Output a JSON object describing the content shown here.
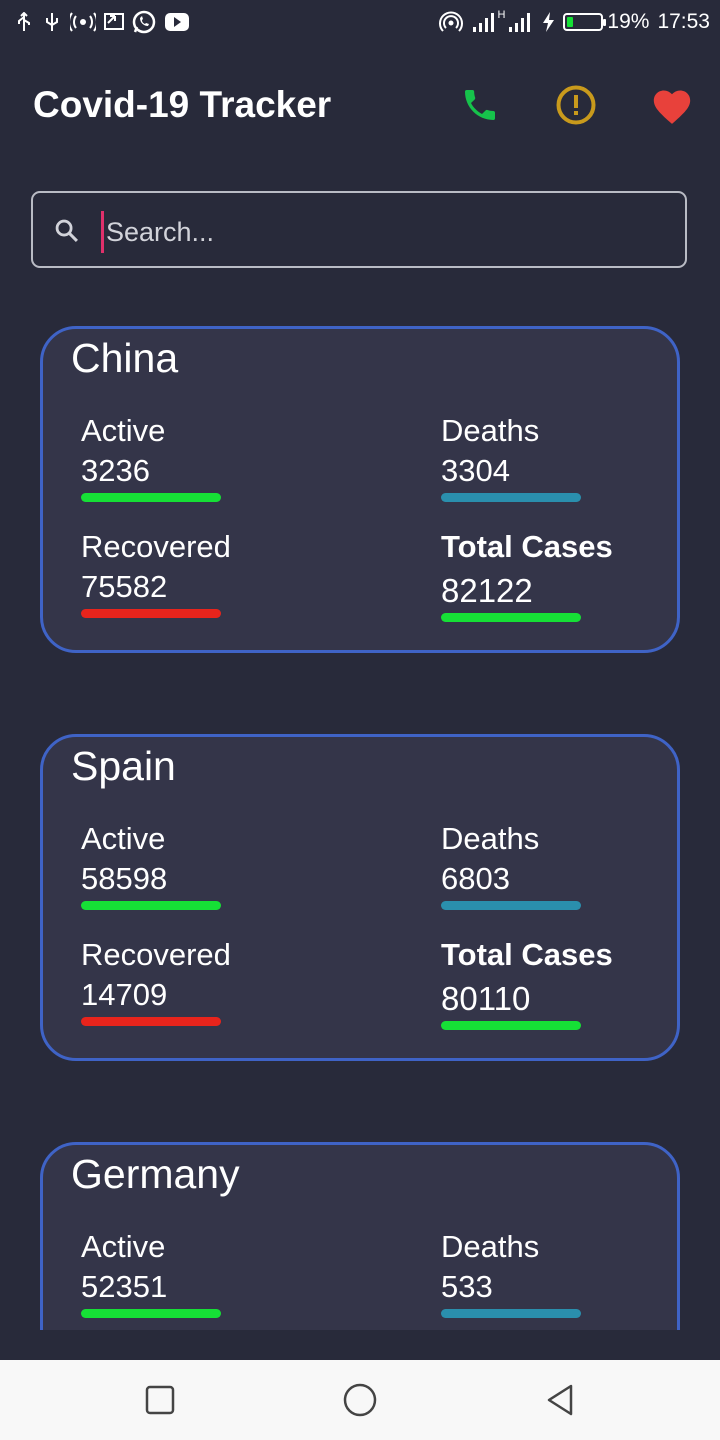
{
  "status_bar": {
    "left_icons": [
      "usb-icon",
      "usb-debug-icon",
      "hotspot-icon",
      "cast-icon",
      "whatsapp-icon",
      "youtube-icon"
    ],
    "battery_percent": "19%",
    "battery_level": 0.19,
    "time": "17:53",
    "signal_label": "H"
  },
  "app": {
    "title": "Covid-19 Tracker",
    "icons": {
      "phone": "phone-icon",
      "alert": "alert-icon",
      "favorite": "heart-icon"
    },
    "colors": {
      "phone": "#16c24b",
      "alert": "#c99a1c",
      "heart": "#e8413b"
    }
  },
  "search": {
    "placeholder": "Search..."
  },
  "labels": {
    "active": "Active",
    "deaths": "Deaths",
    "recovered": "Recovered",
    "total": "Total Cases"
  },
  "colors": {
    "active_bar": "#16e036",
    "deaths_bar": "#2a8fad",
    "recovered_bar": "#e8241c",
    "total_bar": "#16e036",
    "card_border": "#3f63c6"
  },
  "countries": [
    {
      "name": "China",
      "active": "3236",
      "deaths": "3304",
      "recovered": "75582",
      "total": "82122"
    },
    {
      "name": "Spain",
      "active": "58598",
      "deaths": "6803",
      "recovered": "14709",
      "total": "80110"
    },
    {
      "name": "Germany",
      "active": "52351",
      "deaths": "533",
      "recovered": "",
      "total": ""
    }
  ]
}
